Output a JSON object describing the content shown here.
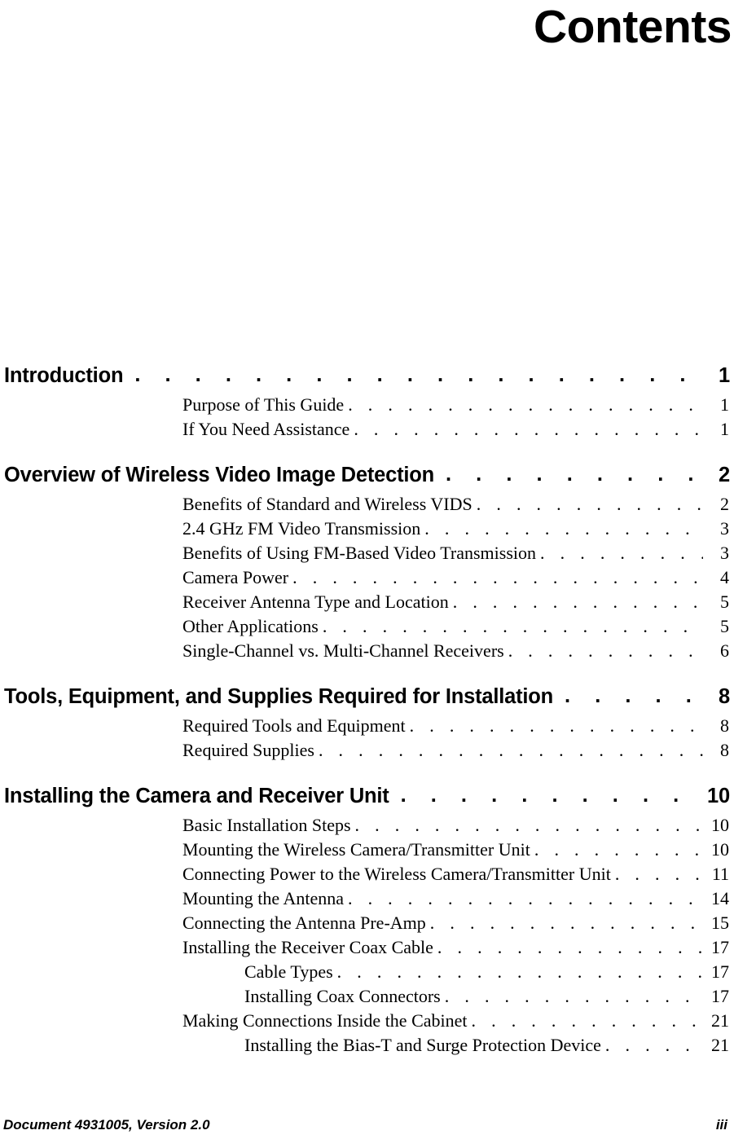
{
  "document": {
    "title": "Contents",
    "footer": {
      "left": "Document 4931005, Version 2.0",
      "right": "iii"
    }
  },
  "leaders": {
    "lvl1": ". . . . . . . . . . . . . . . . . . . . . . . . . . . . . . . . . . . . . . . . . . . . . . . . . . .",
    "lvl2": ". . . . . . . . . . . . . . . . . . . . . . . . . . . . . . . . . . . . . . . . . . . . . . . . . . . . . . . . . . . . . . . . ."
  },
  "toc": {
    "groups": [
      {
        "heading": {
          "label": "Introduction",
          "page": "1",
          "level": 1
        },
        "entries": [
          {
            "label": "Purpose of This Guide",
            "page": "1",
            "level": 2
          },
          {
            "label": "If You Need Assistance",
            "page": "1",
            "level": 2
          }
        ]
      },
      {
        "heading": {
          "label": "Overview of Wireless Video Image Detection",
          "page": "2",
          "level": 1
        },
        "entries": [
          {
            "label": "Benefits of Standard and Wireless VIDS",
            "page": "2",
            "level": 2
          },
          {
            "label": "2.4 GHz FM Video Transmission",
            "page": "3",
            "level": 2
          },
          {
            "label": "Benefits of Using FM-Based Video Transmission",
            "page": "3",
            "level": 2
          },
          {
            "label": "Camera Power",
            "page": "4",
            "level": 2
          },
          {
            "label": "Receiver Antenna Type and Location",
            "page": "5",
            "level": 2
          },
          {
            "label": "Other Applications",
            "page": "5",
            "level": 2
          },
          {
            "label": "Single-Channel vs. Multi-Channel Receivers",
            "page": "6",
            "level": 2
          }
        ]
      },
      {
        "heading": {
          "label": "Tools, Equipment, and Supplies Required for Installation",
          "page": "8",
          "level": 1
        },
        "entries": [
          {
            "label": "Required Tools and Equipment",
            "page": "8",
            "level": 2
          },
          {
            "label": "Required Supplies",
            "page": "8",
            "level": 2
          }
        ]
      },
      {
        "heading": {
          "label": "Installing the Camera and Receiver Unit",
          "page": "10",
          "level": 1
        },
        "entries": [
          {
            "label": "Basic Installation Steps",
            "page": "10",
            "level": 2
          },
          {
            "label": "Mounting the Wireless Camera/Transmitter Unit",
            "page": "10",
            "level": 2
          },
          {
            "label": "Connecting Power to the Wireless Camera/Transmitter Unit",
            "page": "11",
            "level": 2
          },
          {
            "label": "Mounting the Antenna",
            "page": "14",
            "level": 2
          },
          {
            "label": "Connecting the Antenna Pre-Amp",
            "page": "15",
            "level": 2
          },
          {
            "label": "Installing the Receiver Coax Cable",
            "page": "17",
            "level": 2
          },
          {
            "label": "Cable Types",
            "page": "17",
            "level": 3
          },
          {
            "label": "Installing Coax Connectors",
            "page": "17",
            "level": 3
          },
          {
            "label": "Making Connections Inside the Cabinet",
            "page": "21",
            "level": 2
          },
          {
            "label": "Installing the Bias-T and Surge Protection Device",
            "page": "21",
            "level": 3
          }
        ]
      }
    ]
  }
}
